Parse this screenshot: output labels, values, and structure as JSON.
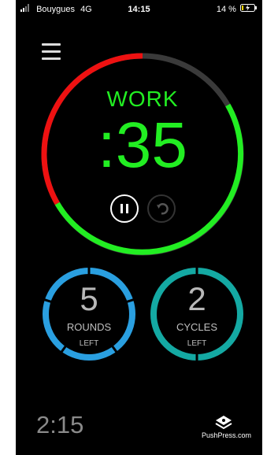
{
  "status_bar": {
    "carrier": "Bouygues",
    "network": "4G",
    "time": "14:15",
    "battery": "14 %",
    "signal_bars": 2,
    "battery_level": 0.14
  },
  "timer": {
    "phase": "WORK",
    "time_remaining": ":35",
    "phase_color": "#22ee22",
    "elapsed_color": "#ee1111",
    "track_color": "#3a3a3a"
  },
  "controls": {
    "pause_icon": "pause-icon",
    "reset_icon": "reset-icon"
  },
  "rounds": {
    "value": "5",
    "label": "ROUNDS",
    "sublabel": "LEFT",
    "color": "#2a9fe0"
  },
  "cycles": {
    "value": "2",
    "label": "CYCLES",
    "sublabel": "LEFT",
    "color": "#14a9a3"
  },
  "footer": {
    "total_time": "2:15",
    "brand": "PushPress.com",
    "brand_icon": "pushpress-logo-icon"
  }
}
